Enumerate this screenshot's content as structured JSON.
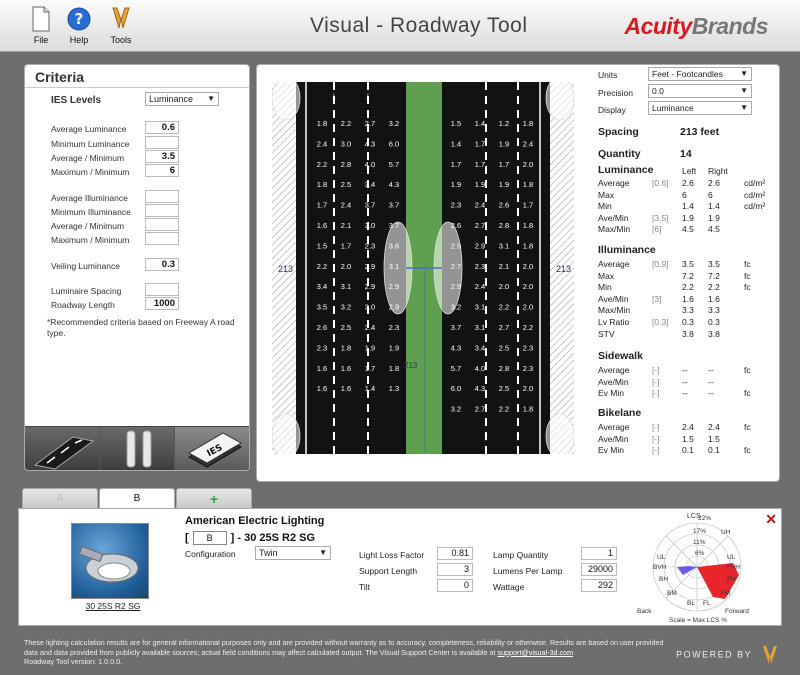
{
  "toolbar": {
    "file_label": "File",
    "help_label": "Help",
    "tools_label": "Tools",
    "title": "Visual - Roadway Tool",
    "brand_part1": "Acuity",
    "brand_part2": "Brands"
  },
  "criteria": {
    "title": "Criteria",
    "ies_levels_label": "IES Levels",
    "ies_levels_value": "Luminance",
    "fields": [
      {
        "label": "Average Luminance",
        "value": "0.6"
      },
      {
        "label": "Minimum Luminance",
        "value": ""
      },
      {
        "label": "Average / Minimum",
        "value": "3.5"
      },
      {
        "label": "Maximum / Minimum",
        "value": "6"
      },
      {
        "label": "Average Illuminance",
        "value": ""
      },
      {
        "label": "Minimum Illuminance",
        "value": ""
      },
      {
        "label": "Average / Minimum",
        "value": ""
      },
      {
        "label": "Maximum / Minimum",
        "value": ""
      },
      {
        "label": "Veiling Luminance",
        "value": "0.3"
      },
      {
        "label": "Luminaire Spacing",
        "value": ""
      },
      {
        "label": "Roadway Length",
        "value": "1000"
      }
    ],
    "note": "*Recommended criteria based on Freeway A road type.",
    "ies_icon_text": "IES"
  },
  "road": {
    "dimension_left": "213",
    "dimension_right": "213",
    "dimension_center": "213",
    "grid_left": [
      [
        "1.8",
        "2.2",
        "2.7",
        "3.2"
      ],
      [
        "2.4",
        "3.0",
        "4.3",
        "6.0"
      ],
      [
        "2.2",
        "2.8",
        "4.0",
        "5.7"
      ],
      [
        "1.8",
        "2.5",
        "3.4",
        "4.3"
      ],
      [
        "1.7",
        "2.4",
        "3.7",
        "3.7"
      ],
      [
        "1.6",
        "2.1",
        "3.0",
        "3.7"
      ],
      [
        "1.5",
        "1.7",
        "2.3",
        "3.6"
      ],
      [
        "2.2",
        "2.0",
        "2.9",
        "3.1"
      ],
      [
        "3.4",
        "3.1",
        "2.9",
        "2.9"
      ],
      [
        "3.5",
        "3.2",
        "3.0",
        "2.9"
      ],
      [
        "2.6",
        "2.5",
        "2.4",
        "2.3"
      ],
      [
        "2.3",
        "1.8",
        "1.9",
        "1.9"
      ],
      [
        "1.6",
        "1.6",
        "1.7",
        "1.8"
      ],
      [
        "1.6",
        "1.6",
        "1.4",
        "1.3"
      ]
    ],
    "grid_right": [
      [
        "1.5",
        "1.4",
        "1.2",
        "1.8"
      ],
      [
        "1.4",
        "1.7",
        "1.9",
        "2.4"
      ],
      [
        "1.7",
        "1.7",
        "1.7",
        "2.0"
      ],
      [
        "1.9",
        "1.9",
        "1.9",
        "1.8"
      ],
      [
        "2.3",
        "2.4",
        "2.6",
        "1.7"
      ],
      [
        "2.6",
        "2.7",
        "2.8",
        "1.8"
      ],
      [
        "2.9",
        "2.9",
        "3.1",
        "1.8"
      ],
      [
        "2.7",
        "2.3",
        "2.1",
        "2.0"
      ],
      [
        "2.9",
        "2.4",
        "2.0",
        "2.0"
      ],
      [
        "3.2",
        "3.1",
        "2.2",
        "2.0"
      ],
      [
        "3.7",
        "3.1",
        "2.7",
        "2.2"
      ],
      [
        "4.3",
        "3.4",
        "2.5",
        "2.3"
      ],
      [
        "5.7",
        "4.0",
        "2.8",
        "2.3"
      ],
      [
        "6.0",
        "4.3",
        "2.5",
        "2.0"
      ],
      [
        "3.2",
        "2.7",
        "2.2",
        "1.8"
      ]
    ]
  },
  "settings": {
    "units_label": "Units",
    "units_value": "Feet - Footcandles",
    "precision_label": "Precision",
    "precision_value": "0.0",
    "display_label": "Display",
    "display_value": "Luminance"
  },
  "results": {
    "spacing_label": "Spacing",
    "spacing_value": "213 feet",
    "quantity_label": "Quantity",
    "quantity_value": "14",
    "luminance": {
      "title": "Luminance",
      "col_left": "Left",
      "col_right": "Right",
      "rows": [
        {
          "label": "Average",
          "target": "[0.6]",
          "left": "2.6",
          "right": "2.6",
          "unit": "cd/m²"
        },
        {
          "label": "Max",
          "target": "",
          "left": "6",
          "right": "6",
          "unit": "cd/m²"
        },
        {
          "label": "Min",
          "target": "",
          "left": "1.4",
          "right": "1.4",
          "unit": "cd/m²"
        },
        {
          "label": "Ave/Min",
          "target": "[3.5]",
          "left": "1.9",
          "right": "1.9",
          "unit": ""
        },
        {
          "label": "Max/Min",
          "target": "[6]",
          "left": "4.5",
          "right": "4.5",
          "unit": ""
        }
      ]
    },
    "illuminance": {
      "title": "Illuminance",
      "rows": [
        {
          "label": "Average",
          "target": "[0.9]",
          "left": "3.5",
          "right": "3.5",
          "unit": "fc"
        },
        {
          "label": "Max",
          "target": "",
          "left": "7.2",
          "right": "7.2",
          "unit": "fc"
        },
        {
          "label": "Min",
          "target": "",
          "left": "2.2",
          "right": "2.2",
          "unit": "fc"
        },
        {
          "label": "Ave/Min",
          "target": "[3]",
          "left": "1.6",
          "right": "1.6",
          "unit": ""
        },
        {
          "label": "Max/Min",
          "target": "",
          "left": "3.3",
          "right": "3.3",
          "unit": ""
        },
        {
          "label": "Lv Ratio",
          "target": "[0.3]",
          "left": "0.3",
          "right": "0.3",
          "unit": ""
        },
        {
          "label": "STV",
          "target": "",
          "left": "3.8",
          "right": "3.8",
          "unit": ""
        }
      ]
    },
    "sidewalk": {
      "title": "Sidewalk",
      "rows": [
        {
          "label": "Average",
          "target": "[-]",
          "left": "--",
          "right": "--",
          "unit": "fc"
        },
        {
          "label": "Ave/Min",
          "target": "[-]",
          "left": "--",
          "right": "--",
          "unit": ""
        },
        {
          "label": "Ev Min",
          "target": "[-]",
          "left": "--",
          "right": "--",
          "unit": "fc"
        }
      ]
    },
    "bikelane": {
      "title": "Bikelane",
      "rows": [
        {
          "label": "Average",
          "target": "[-]",
          "left": "2.4",
          "right": "2.4",
          "unit": "fc"
        },
        {
          "label": "Ave/Min",
          "target": "[-]",
          "left": "1.5",
          "right": "1.5",
          "unit": ""
        },
        {
          "label": "Ev Min",
          "target": "[-]",
          "left": "0.1",
          "right": "0.1",
          "unit": "fc"
        }
      ]
    }
  },
  "tabs": [
    {
      "label": "A"
    },
    {
      "label": "B"
    },
    {
      "label": "+"
    }
  ],
  "detail": {
    "manufacturer": "American Electric Lighting",
    "model_prefix": "[",
    "model_box": "B",
    "model_suffix": "] - 30 25S R2 SG",
    "luminaire_caption": "30 25S R2 SG",
    "configuration_label": "Configuration",
    "configuration_value": "Twin",
    "light_loss_factor_label": "Light Loss Factor",
    "light_loss_factor_value": "0.81",
    "support_length_label": "Support Length",
    "support_length_value": "3",
    "tilt_label": "Tilt",
    "tilt_value": "0",
    "lamp_quantity_label": "Lamp Quantity",
    "lamp_quantity_value": "1",
    "lumens_per_lamp_label": "Lumens Per Lamp",
    "lumens_per_lamp_value": "29000",
    "wattage_label": "Wattage",
    "wattage_value": "292",
    "polar": {
      "lcs": "LCS",
      "pct22": "22%",
      "pct17": "17%",
      "pct11": "11%",
      "pct6": "6%",
      "uh": "UH",
      "ul_left": "UL",
      "ul_right": "UL",
      "bvh": "BVH",
      "fvh": "FVH",
      "bh": "BH",
      "fh": "FH",
      "bm": "BM",
      "fm": "FM",
      "bl": "BL",
      "fl": "FL",
      "back": "Back",
      "forward": "Forward",
      "scale": "Scale = Max LCS %"
    }
  },
  "footer": {
    "text": "These lighting calculation results are for general informational purposes only and are provided without warranty as to accuracy, completeness, reliability or otherwise. Results are based on user provided data and data provided from publicly available sources; actual field conditions may affect calculated output. The Visual Support Center is available at",
    "email": "support@visual-3d.com",
    "version": "Roadway Tool version: 1.0.0.0.",
    "powered_by": "POWERED BY"
  },
  "colors": {
    "asphalt": "#121212",
    "median": "#5f9f50",
    "brand_red": "#d71920",
    "lcs_red": "#e8252b",
    "lcs_blue": "#6b5ce6"
  }
}
